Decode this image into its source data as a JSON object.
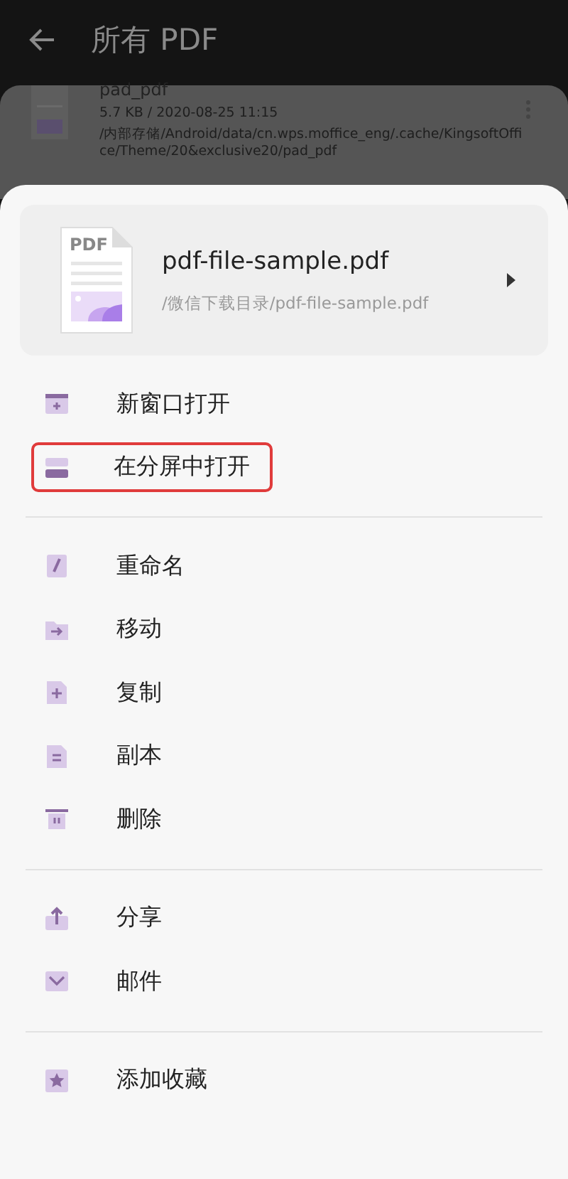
{
  "header": {
    "title": "所有 PDF"
  },
  "background_file": {
    "name": "pad_pdf",
    "meta": "5.7 KB / 2020-08-25 11:15",
    "path": "/内部存储/Android/data/cn.wps.moffice_eng/.cache/KingsoftOffice/Theme/20&exclusive20/pad_pdf"
  },
  "sheet": {
    "file": {
      "name": "pdf-file-sample.pdf",
      "path": "/微信下载目录/pdf-file-sample.pdf",
      "icon_label": "PDF"
    },
    "groups": [
      [
        {
          "kind": "new-window",
          "label": "新窗口打开",
          "highlighted": false
        },
        {
          "kind": "split",
          "label": "在分屏中打开",
          "highlighted": true
        }
      ],
      [
        {
          "kind": "rename",
          "label": "重命名",
          "highlighted": false
        },
        {
          "kind": "move",
          "label": "移动",
          "highlighted": false
        },
        {
          "kind": "copy",
          "label": "复制",
          "highlighted": false
        },
        {
          "kind": "duplicate",
          "label": "副本",
          "highlighted": false
        },
        {
          "kind": "delete",
          "label": "删除",
          "highlighted": false
        }
      ],
      [
        {
          "kind": "share",
          "label": "分享",
          "highlighted": false
        },
        {
          "kind": "mail",
          "label": "邮件",
          "highlighted": false
        }
      ],
      [
        {
          "kind": "favorite",
          "label": "添加收藏",
          "highlighted": false
        }
      ]
    ]
  }
}
